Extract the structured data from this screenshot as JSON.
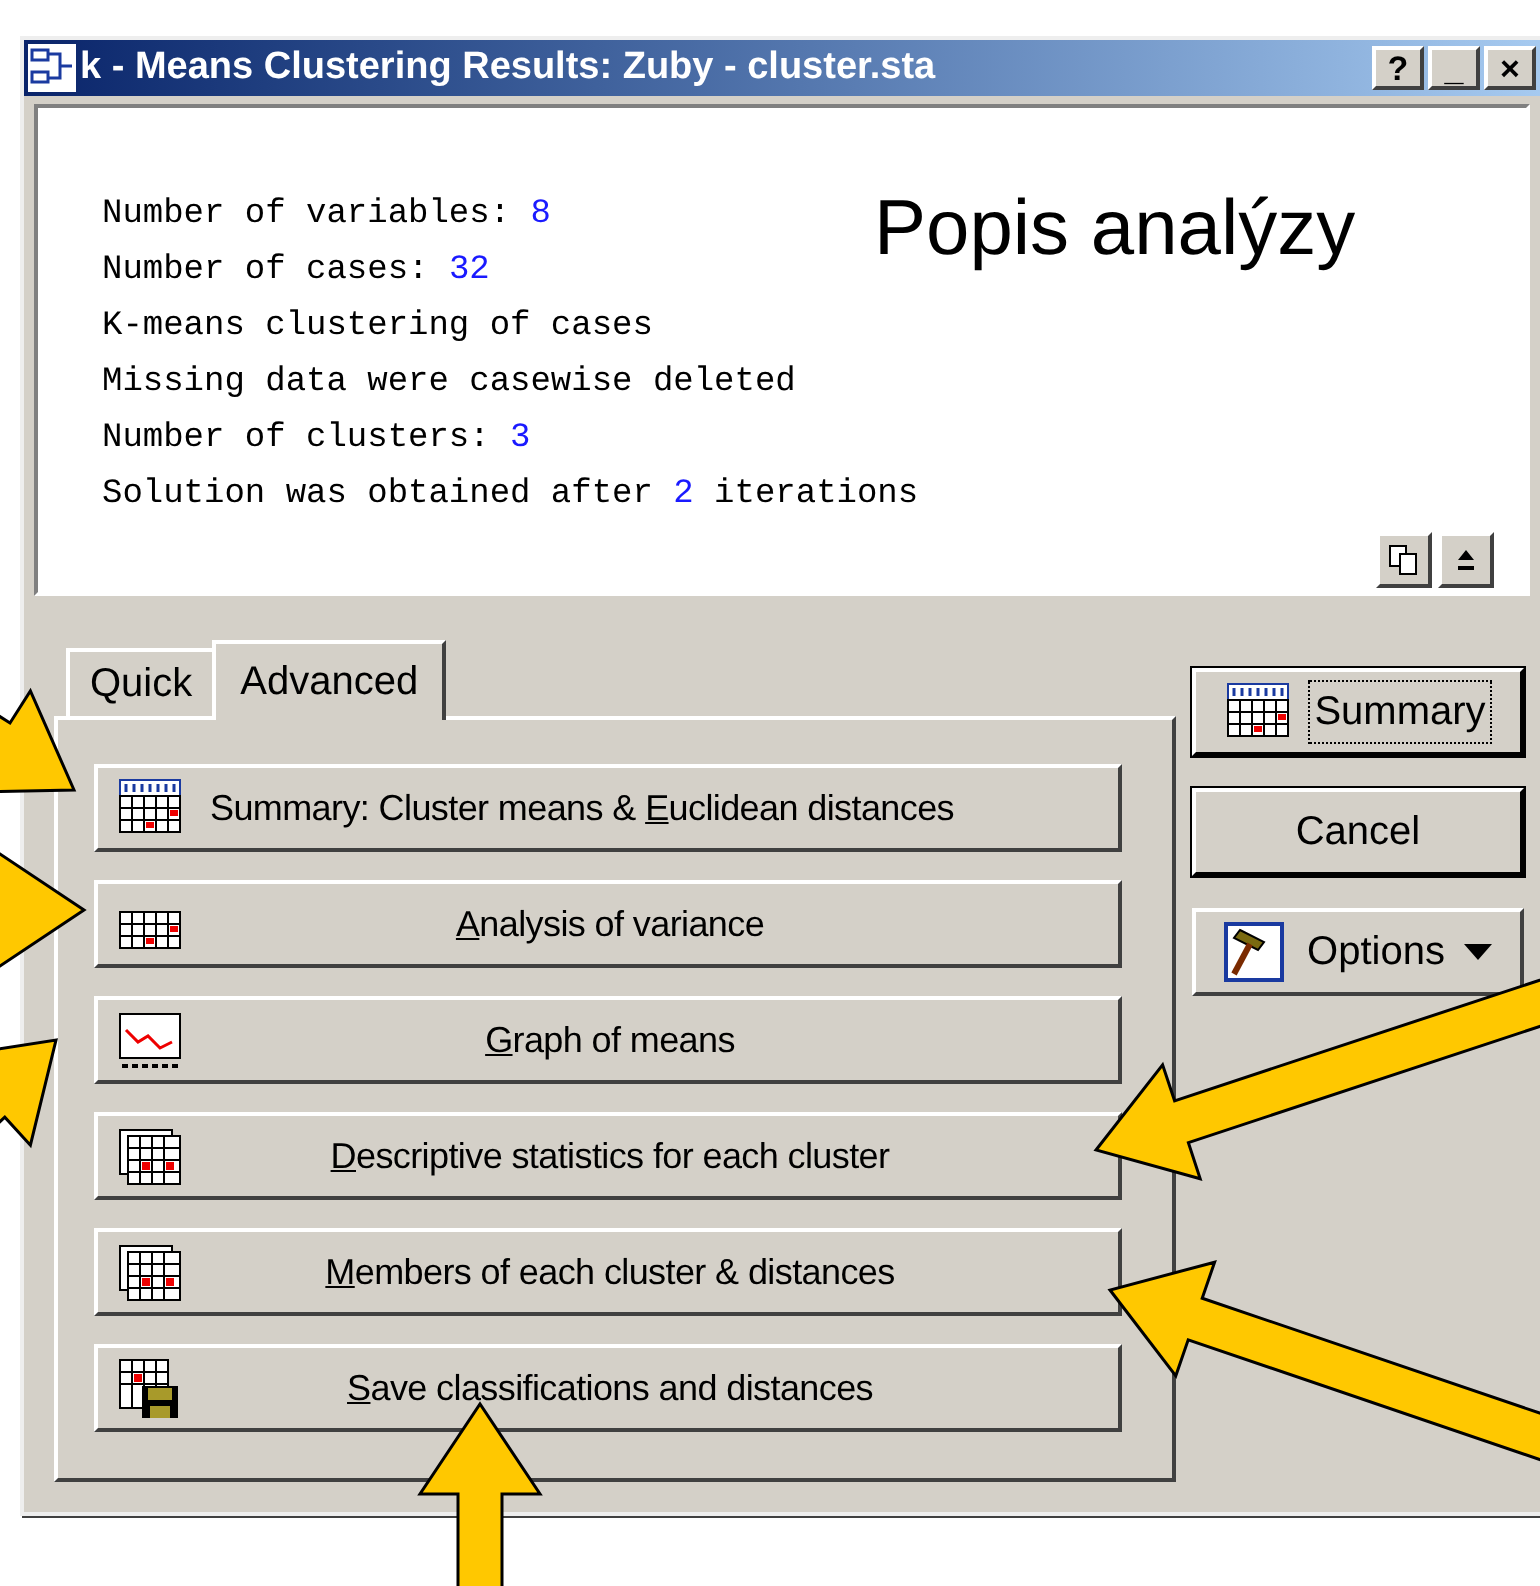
{
  "window": {
    "title": "k - Means Clustering Results: Zuby - cluster.sta",
    "title_buttons": [
      "?",
      "_",
      "×"
    ]
  },
  "output": {
    "lines": [
      {
        "text": "Number of variables: ",
        "value": "8"
      },
      {
        "text": "Number of cases: ",
        "value": "32"
      },
      {
        "text": "K-means clustering of cases"
      },
      {
        "text": "Missing data were casewise deleted"
      },
      {
        "text": "Number of clusters: ",
        "value": "3"
      },
      {
        "text": "Solution was obtained after ",
        "value": "2",
        "after": " iterations"
      }
    ]
  },
  "annotation_label": "Popis analýzy",
  "tabs": [
    {
      "label": "Quick",
      "selected": false
    },
    {
      "label": "Advanced",
      "selected": true
    }
  ],
  "buttons": [
    {
      "kind": "summary",
      "pre": "Summary: Cluster means & ",
      "key": "E",
      "post": "uclidean distances"
    },
    {
      "kind": "table",
      "key": "A",
      "post": "nalysis of variance"
    },
    {
      "kind": "graph",
      "key": "G",
      "post": "raph of means"
    },
    {
      "kind": "tables",
      "key": "D",
      "post": "escriptive statistics for each cluster"
    },
    {
      "kind": "tables",
      "key": "M",
      "post": "embers of each cluster & distances"
    },
    {
      "kind": "save",
      "key": "S",
      "post": "ave classifications and distances"
    }
  ],
  "side_buttons": [
    {
      "kind": "summary",
      "label": "Summary",
      "focused": true
    },
    {
      "kind": "plain",
      "label": "Cancel",
      "focused": false
    },
    {
      "kind": "options",
      "label": "Options",
      "focused": false
    }
  ]
}
